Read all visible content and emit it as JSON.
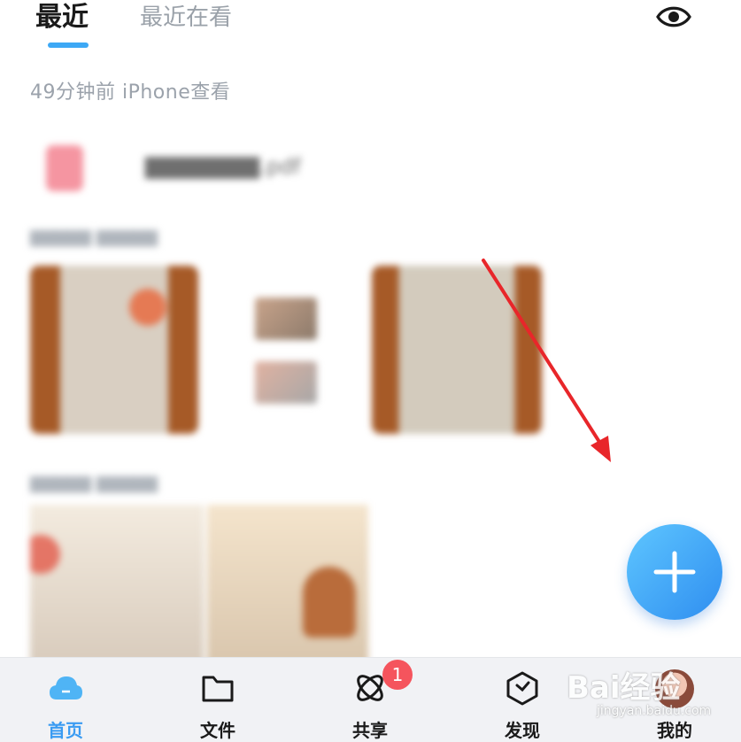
{
  "tabs": {
    "recent": "最近",
    "viewing": "最近在看"
  },
  "recent_section": {
    "header": "49分钟前 iPhone查看"
  },
  "colors": {
    "accent": "#3da8f5",
    "fab": "#3a9bf2",
    "badge": "#f5545d",
    "annotation_arrow": "#e8262a"
  },
  "icons": {
    "eye": "eye-icon",
    "add": "plus-icon",
    "home": "cloud-icon",
    "files": "folder-icon",
    "share": "orbit-icon",
    "discover": "compass-box-icon"
  },
  "bottom_nav": {
    "items": [
      {
        "label": "首页",
        "active": true
      },
      {
        "label": "文件"
      },
      {
        "label": "共享"
      },
      {
        "label": "发现"
      },
      {
        "label": "我的"
      }
    ],
    "share_badge": "1"
  },
  "watermark": {
    "logo": "Bai经验",
    "url": "jingyan.baidu.com"
  }
}
